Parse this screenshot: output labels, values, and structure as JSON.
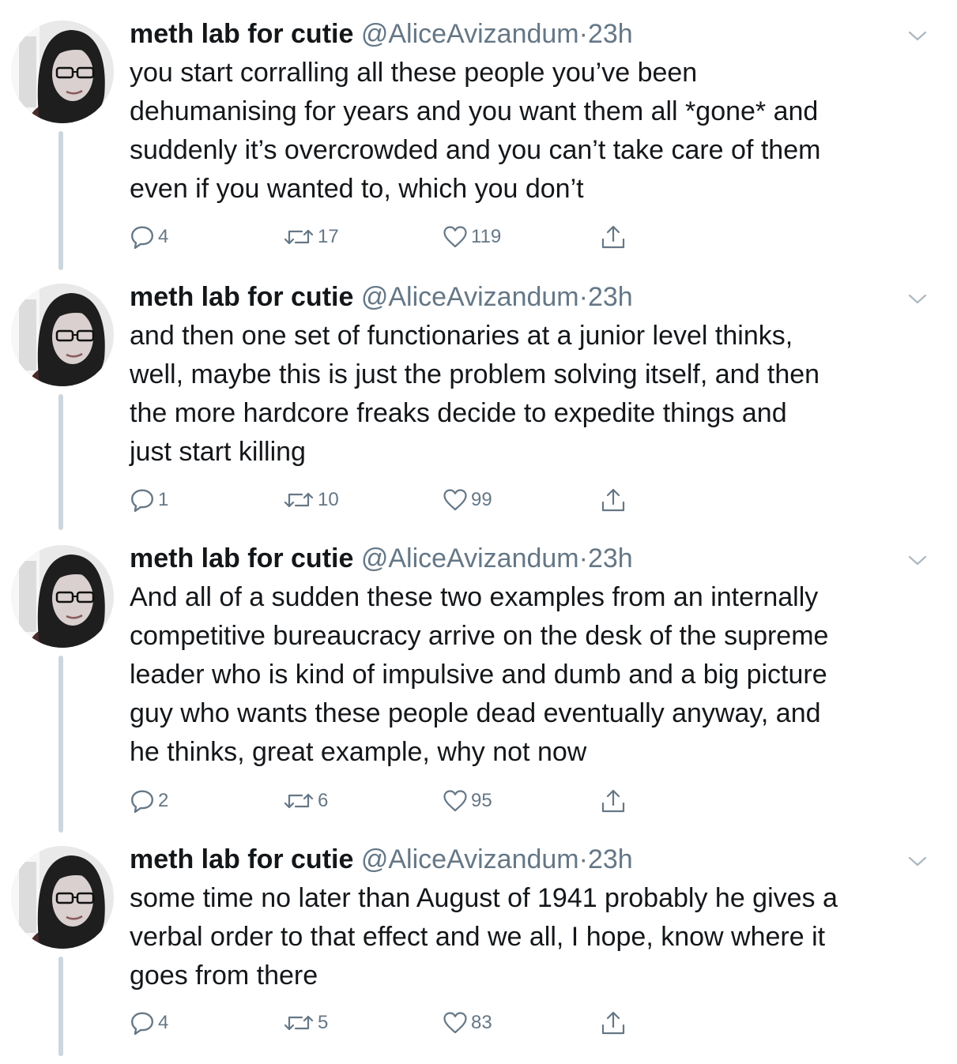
{
  "colors": {
    "text": "#14171a",
    "secondary": "#657786",
    "thread": "#ccd6dd",
    "background": "#ffffff"
  },
  "icons": {
    "reply": "reply-icon",
    "retweet": "retweet-icon",
    "like": "heart-icon",
    "share": "share-icon",
    "menu": "chevron-down-icon"
  },
  "tweets": [
    {
      "name": "meth lab for cutie",
      "handle": "@AliceAvizandum",
      "separator": "·",
      "time": "23h",
      "text": "you start corralling all these people you’ve been\ndehumanising for years and you want them all *gone* and\nsuddenly it’s overcrowded and you can’t take care of them\neven if you wanted to, which you don’t",
      "replies": "4",
      "retweets": "17",
      "likes": "119"
    },
    {
      "name": "meth lab for cutie",
      "handle": "@AliceAvizandum",
      "separator": "·",
      "time": "23h",
      "text": "and then one set of functionaries at a junior level thinks,\nwell, maybe this is just the problem solving itself, and then\nthe more hardcore freaks decide to expedite things and\njust start killing",
      "replies": "1",
      "retweets": "10",
      "likes": "99"
    },
    {
      "name": "meth lab for cutie",
      "handle": "@AliceAvizandum",
      "separator": "·",
      "time": "23h",
      "text": "And all of a sudden these two examples from an internally\ncompetitive bureaucracy arrive on the desk of the supreme\nleader who is kind of impulsive and dumb and a big picture\nguy who wants these people dead eventually anyway, and\nhe thinks, great example, why not now",
      "replies": "2",
      "retweets": "6",
      "likes": "95"
    },
    {
      "name": "meth lab for cutie",
      "handle": "@AliceAvizandum",
      "separator": "·",
      "time": "23h",
      "text": "some time no later than August of 1941 probably he gives a\nverbal order to that effect and we all, I hope, know where it\ngoes from there",
      "replies": "4",
      "retweets": "5",
      "likes": "83"
    }
  ]
}
